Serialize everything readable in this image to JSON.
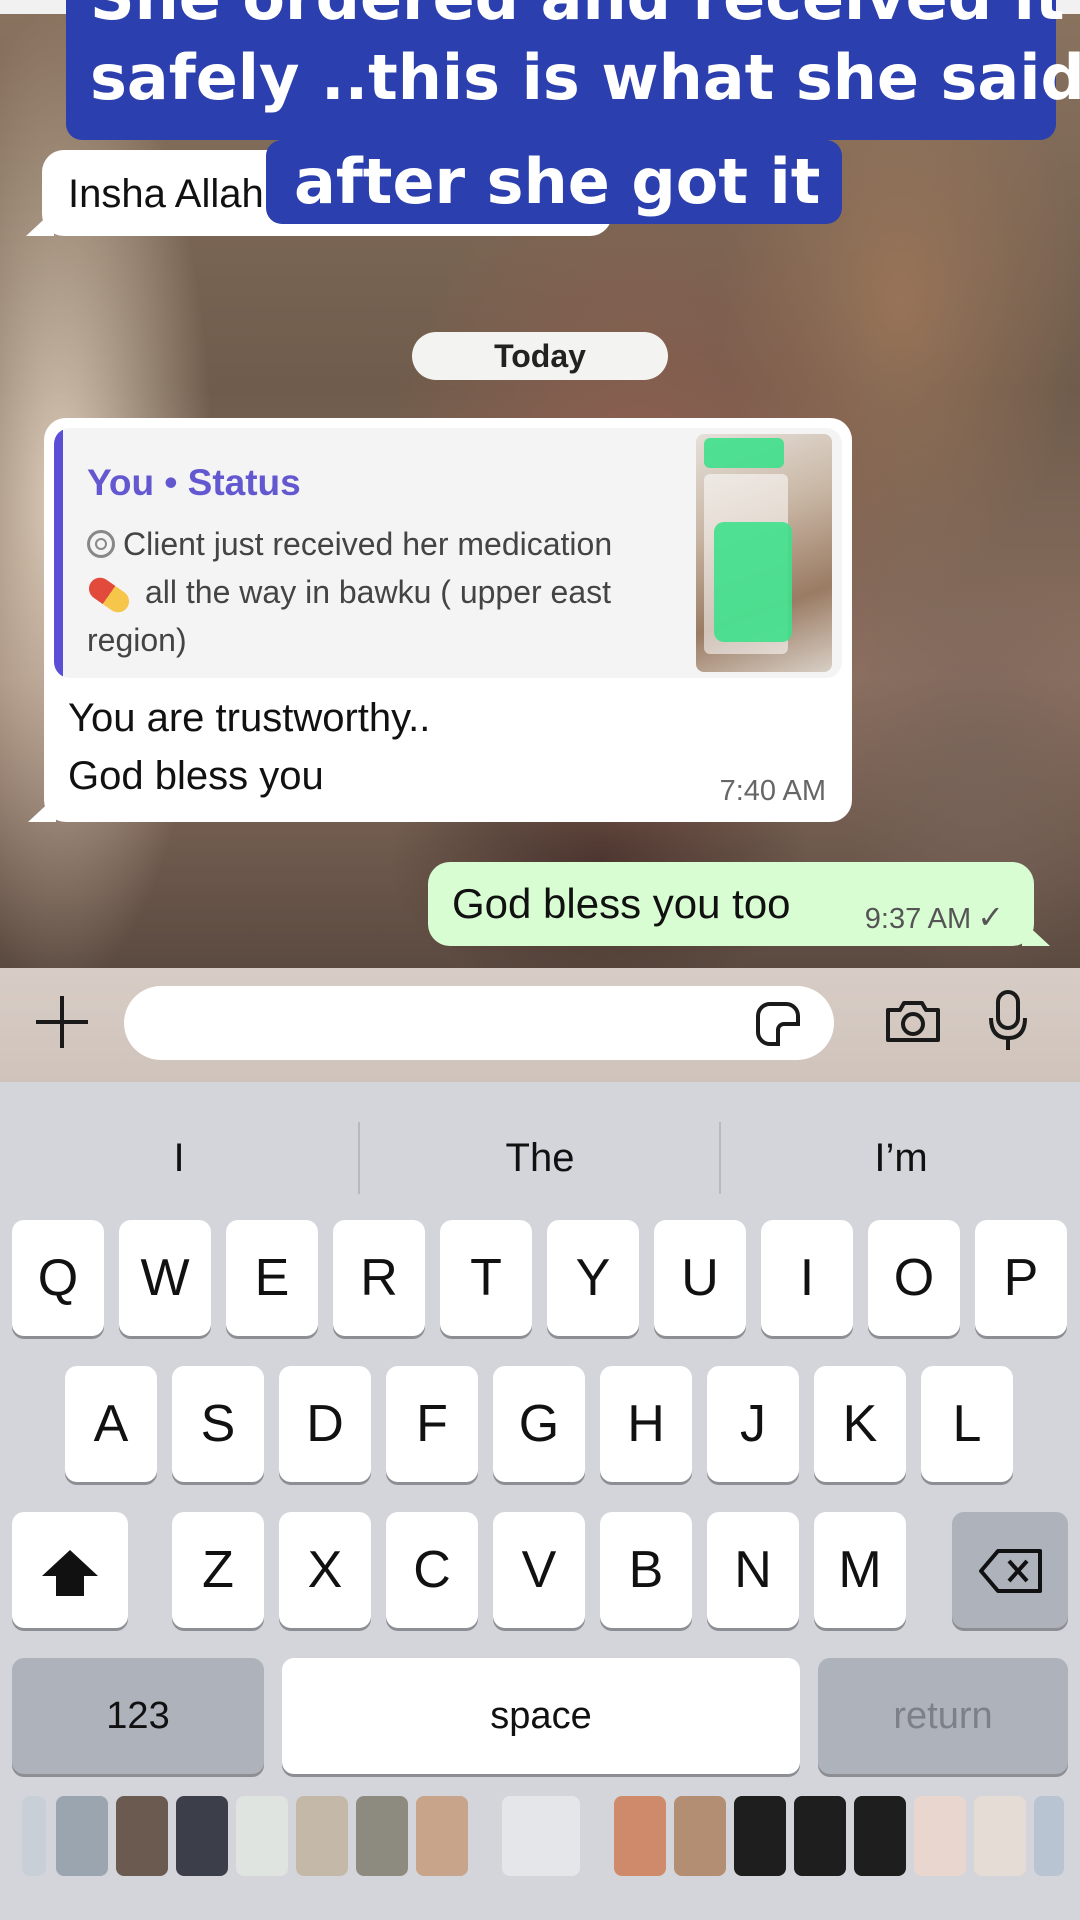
{
  "caption": {
    "line1": "She ordered and received it",
    "line2": "safely ..this is what she said",
    "line3": "after she got it"
  },
  "messages": {
    "incoming_partial": "Insha Allah",
    "date_separator": "Today",
    "reply": {
      "quote_author": "You • Status",
      "quote_text_1": "Client just received her medication",
      "quote_text_2": "all the way in bawku ( upper east",
      "quote_text_3": "region)",
      "text_line_1": "You are trustworthy..",
      "text_line_2": "God bless you",
      "time": "7:40 AM"
    },
    "outgoing": {
      "text": "God bless you too",
      "time": "9:37 AM",
      "check": "✓"
    }
  },
  "input_bar": {
    "placeholder": "",
    "icons": [
      "plus-icon",
      "sticker-icon",
      "camera-icon",
      "microphone-icon"
    ]
  },
  "keyboard": {
    "suggestions": [
      "I",
      "The",
      "I’m"
    ],
    "row1": [
      "Q",
      "W",
      "E",
      "R",
      "T",
      "Y",
      "U",
      "I",
      "O",
      "P"
    ],
    "row2": [
      "A",
      "S",
      "D",
      "F",
      "G",
      "H",
      "J",
      "K",
      "L"
    ],
    "row3": [
      "Z",
      "X",
      "C",
      "V",
      "B",
      "N",
      "M"
    ],
    "numbers_label": "123",
    "space_label": "space",
    "return_label": "return"
  },
  "colors": {
    "caption_bg": "#2b3fae",
    "outgoing_bubble": "#d9fdd3",
    "quote_accent": "#5c4fd6"
  }
}
